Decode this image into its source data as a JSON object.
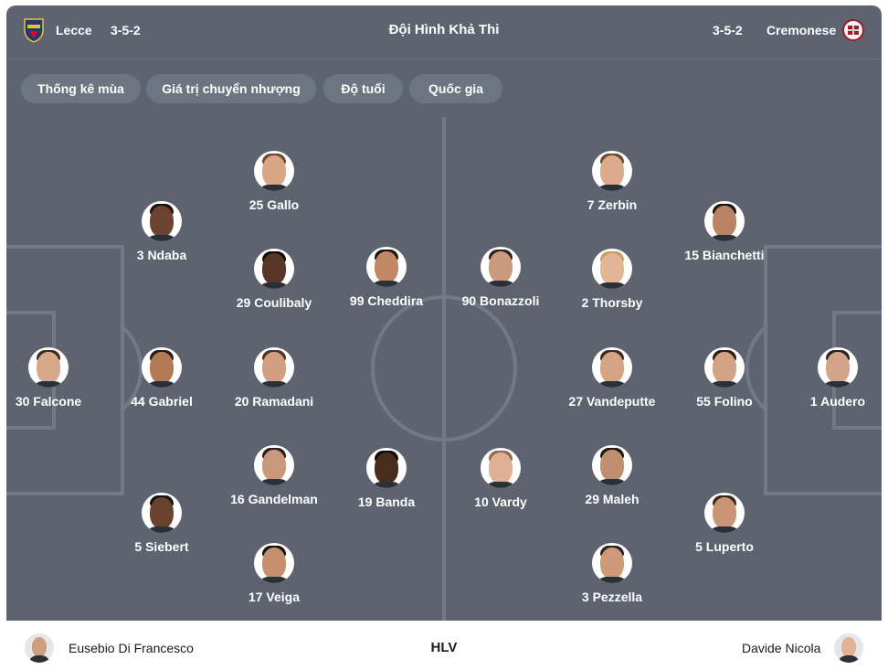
{
  "header": {
    "home_team": "Lecce",
    "home_formation": "3-5-2",
    "title": "Đội Hình Khả Thi",
    "away_formation": "3-5-2",
    "away_team": "Cremonese",
    "home_logo_icon": "lecce-crest-icon",
    "away_logo_icon": "cremonese-crest-icon"
  },
  "tabs": [
    {
      "label": "Thống kê mùa"
    },
    {
      "label": "Giá trị chuyển nhượng"
    },
    {
      "label": "Độ tuổi"
    },
    {
      "label": "Quốc gia"
    }
  ],
  "home_players": [
    {
      "label": "30 Falcone"
    },
    {
      "label": "3 Ndaba"
    },
    {
      "label": "44 Gabriel"
    },
    {
      "label": "5 Siebert"
    },
    {
      "label": "25 Gallo"
    },
    {
      "label": "29 Coulibaly"
    },
    {
      "label": "20 Ramadani"
    },
    {
      "label": "16 Gandelman"
    },
    {
      "label": "17 Veiga"
    },
    {
      "label": "99 Cheddira"
    },
    {
      "label": "19 Banda"
    }
  ],
  "away_players": [
    {
      "label": "1 Audero"
    },
    {
      "label": "15 Bianchetti"
    },
    {
      "label": "55 Folino"
    },
    {
      "label": "5 Luperto"
    },
    {
      "label": "7 Zerbin"
    },
    {
      "label": "2 Thorsby"
    },
    {
      "label": "27 Vandeputte"
    },
    {
      "label": "29 Maleh"
    },
    {
      "label": "3 Pezzella"
    },
    {
      "label": "90 Bonazzoli"
    },
    {
      "label": "10 Vardy"
    }
  ],
  "footer": {
    "home_coach": "Eusebio Di Francesco",
    "label": "HLV",
    "away_coach": "Davide Nicola"
  },
  "colors": {
    "pitch": "#5d6470",
    "pitch_lines": "#727986",
    "tab_bg": "#6e7582",
    "text": "#ffffff"
  }
}
